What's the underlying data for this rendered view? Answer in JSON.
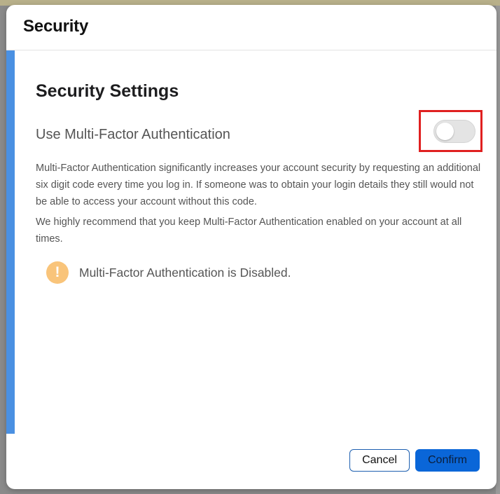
{
  "modal": {
    "title": "Security"
  },
  "section": {
    "heading": "Security Settings"
  },
  "mfa": {
    "label": "Use Multi-Factor Authentication",
    "enabled": false,
    "description": [
      "Multi-Factor Authentication significantly increases your account security by requesting an additional six digit code every time you log in. If someone was to obtain your login details they still would not be able to access your account without this code.",
      "We highly recommend that you keep Multi-Factor Authentication enabled on your account at all times."
    ],
    "status_icon": "warning-icon",
    "status_icon_glyph": "!",
    "status_text": "Multi-Factor Authentication is Disabled."
  },
  "footer": {
    "cancel_label": "Cancel",
    "confirm_label": "Confirm"
  },
  "colors": {
    "accent_bar": "#4a90e2",
    "primary_button": "#0a66d8",
    "warning": "#f9c47a",
    "highlight": "#e02020"
  }
}
